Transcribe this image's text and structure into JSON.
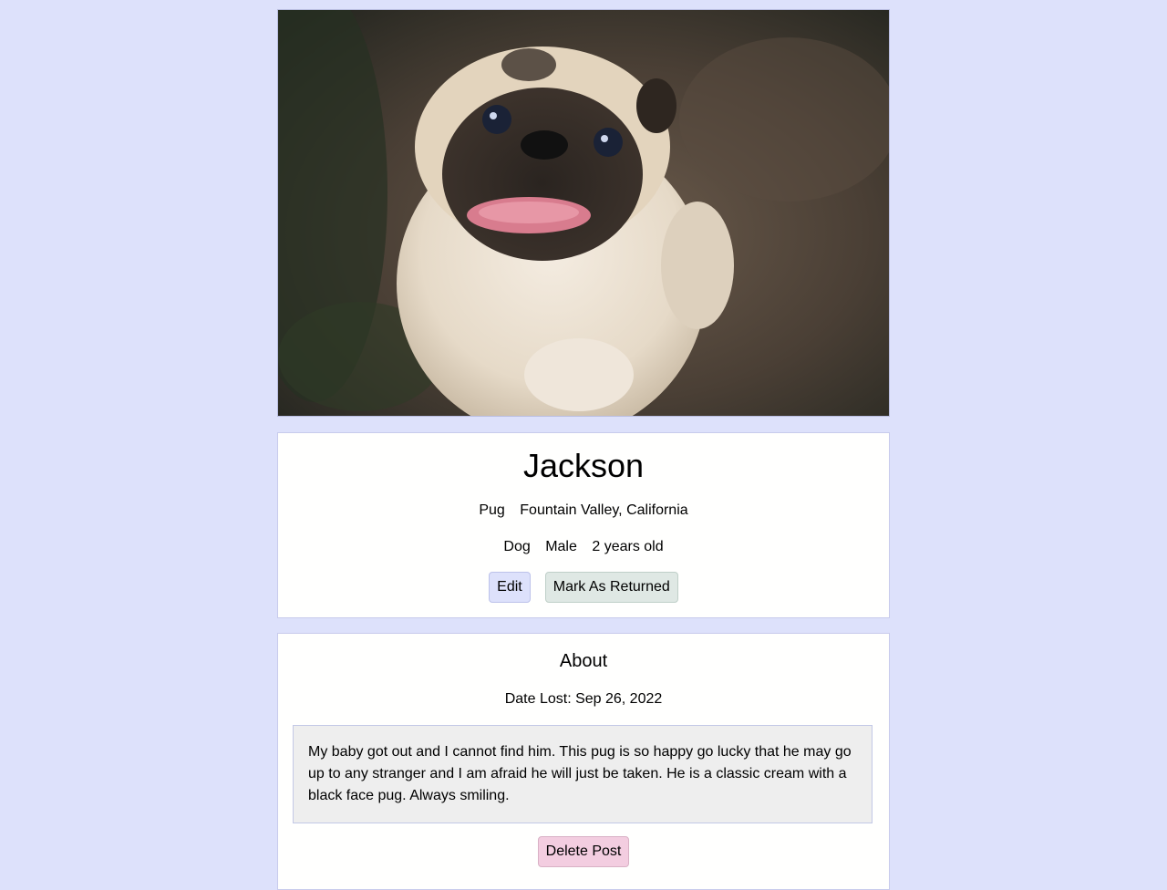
{
  "pet": {
    "photo_alt": "pug-photo",
    "name": "Jackson",
    "breed": "Pug",
    "location": "Fountain Valley, California",
    "species": "Dog",
    "sex": "Male",
    "age": "2 years old"
  },
  "actions": {
    "edit_label": "Edit",
    "returned_label": "Mark As Returned",
    "delete_label": "Delete Post"
  },
  "about": {
    "title": "About",
    "date_lost": "Date Lost: Sep 26, 2022",
    "description": "My baby got out and I cannot find him. This pug is so happy go lucky that he may go up to any stranger and I am afraid he will just be taken. He is a classic cream with a black face pug. Always smiling."
  },
  "colors": {
    "page_background": "#dde1fb",
    "edit_button": "#dde1fb",
    "returned_button": "#dfe8e4",
    "delete_button": "#f3cde0"
  }
}
